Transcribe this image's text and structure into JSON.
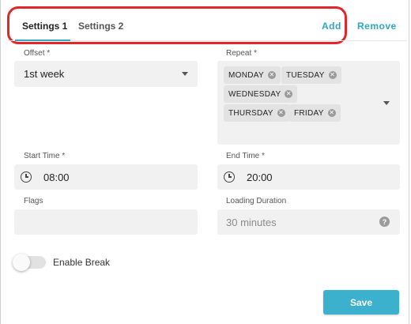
{
  "tabs": [
    {
      "label": "Settings 1",
      "active": true
    },
    {
      "label": "Settings 2",
      "active": false
    }
  ],
  "actions": {
    "add_label": "Add",
    "remove_label": "Remove"
  },
  "colors": {
    "accent": "#3bb1cd",
    "highlight": "#e3262a"
  },
  "form": {
    "offset": {
      "label": "Offset *",
      "value": "1st week"
    },
    "repeat": {
      "label": "Repeat *",
      "chips": [
        "MONDAY",
        "TUESDAY",
        "WEDNESDAY",
        "THURSDAY",
        "FRIDAY"
      ]
    },
    "start_time": {
      "label": "Start Time *",
      "value": "08:00",
      "icon": "clock-icon"
    },
    "end_time": {
      "label": "End Time *",
      "value": "20:00",
      "icon": "clock-icon"
    },
    "flags": {
      "label": "Flags",
      "value": ""
    },
    "loading_duration": {
      "label": "Loading Duration",
      "placeholder": "30 minutes",
      "help_icon": "?"
    },
    "enable_break": {
      "label": "Enable Break",
      "checked": false
    }
  },
  "save_label": "Save"
}
